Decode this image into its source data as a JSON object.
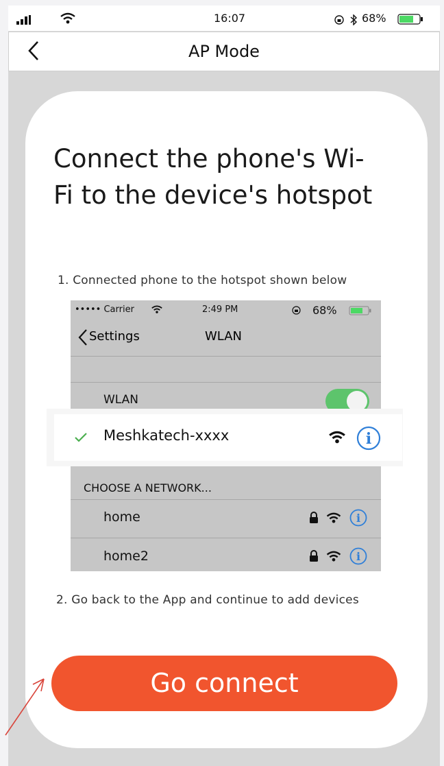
{
  "status_bar": {
    "time": "16:07",
    "battery": "68%"
  },
  "nav": {
    "title": "AP Mode"
  },
  "heading": "Connect the phone's Wi-Fi to the device's hotspot",
  "steps": {
    "step1": "1. Connected phone to the hotspot shown below",
    "step2": "2. Go back to the App and continue to add devices"
  },
  "illustration": {
    "status": {
      "carrier": "••••• Carrier",
      "time": "2:49 PM",
      "battery": "68%"
    },
    "back_label": "Settings",
    "title": "WLAN",
    "wlan_label": "WLAN",
    "connected_network": "Meshkatech-xxxx",
    "section_header": "CHOOSE A NETWORK...",
    "networks": [
      "home",
      "home2"
    ]
  },
  "actions": {
    "go_connect": "Go connect"
  },
  "colors": {
    "accent": "#f1552e",
    "toggle": "#5dc46c",
    "info": "#2f7fd8",
    "check": "#4caf50"
  }
}
